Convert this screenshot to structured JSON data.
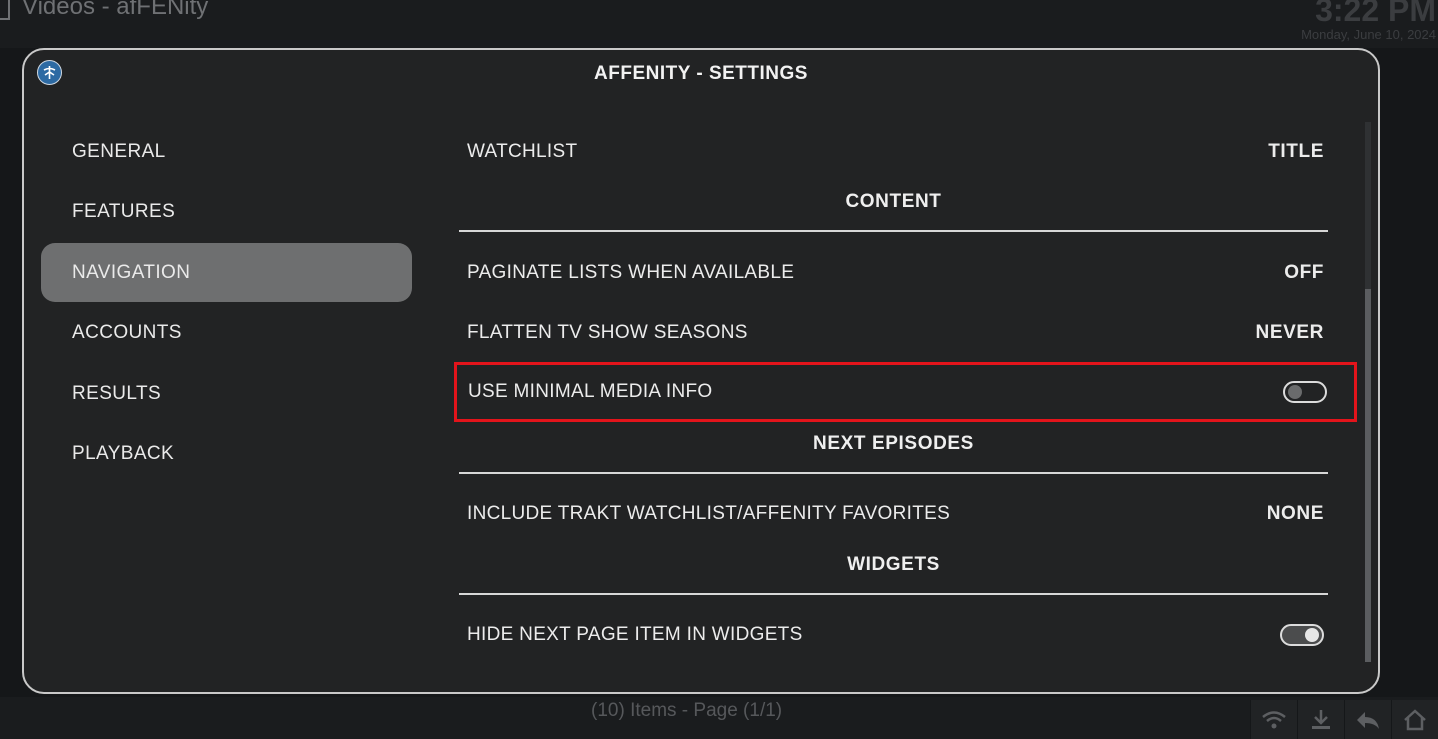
{
  "background": {
    "breadcrumb_section": "Videos",
    "breadcrumb_sep": " - ",
    "breadcrumb_addon": "afFENity",
    "clock": "3:22 PM",
    "date": "Monday, June 10, 2024",
    "footer_status": "(10) Items - Page (1/1)",
    "footer_icons": [
      "wifi-icon",
      "download-icon",
      "back-icon",
      "home-icon"
    ]
  },
  "dialog": {
    "title": "AFFENITY - SETTINGS",
    "logo_icon": "affenity-logo-icon"
  },
  "categories": [
    {
      "label": "GENERAL",
      "active": false
    },
    {
      "label": "FEATURES",
      "active": false
    },
    {
      "label": "NAVIGATION",
      "active": true
    },
    {
      "label": "ACCOUNTS",
      "active": false
    },
    {
      "label": "RESULTS",
      "active": false
    },
    {
      "label": "PLAYBACK",
      "active": false
    }
  ],
  "settings": {
    "watchlist": {
      "label": "WATCHLIST",
      "value": "TITLE"
    },
    "section_content": "CONTENT",
    "paginate": {
      "label": "PAGINATE LISTS WHEN AVAILABLE",
      "value": "OFF"
    },
    "flatten": {
      "label": "FLATTEN TV SHOW SEASONS",
      "value": "NEVER"
    },
    "minimal_media": {
      "label": "USE MINIMAL MEDIA INFO",
      "toggle": false
    },
    "section_next_episodes": "NEXT EPISODES",
    "include_trakt": {
      "label": "INCLUDE TRAKT WATCHLIST/AFFENITY FAVORITES",
      "value": "NONE"
    },
    "section_widgets": "WIDGETS",
    "hide_next_page": {
      "label": "HIDE NEXT PAGE ITEM IN WIDGETS",
      "toggle": true
    }
  },
  "colors": {
    "highlight_border": "#e3141b",
    "active_category_bg": "#6e6f70",
    "dialog_bg": "#222324"
  }
}
